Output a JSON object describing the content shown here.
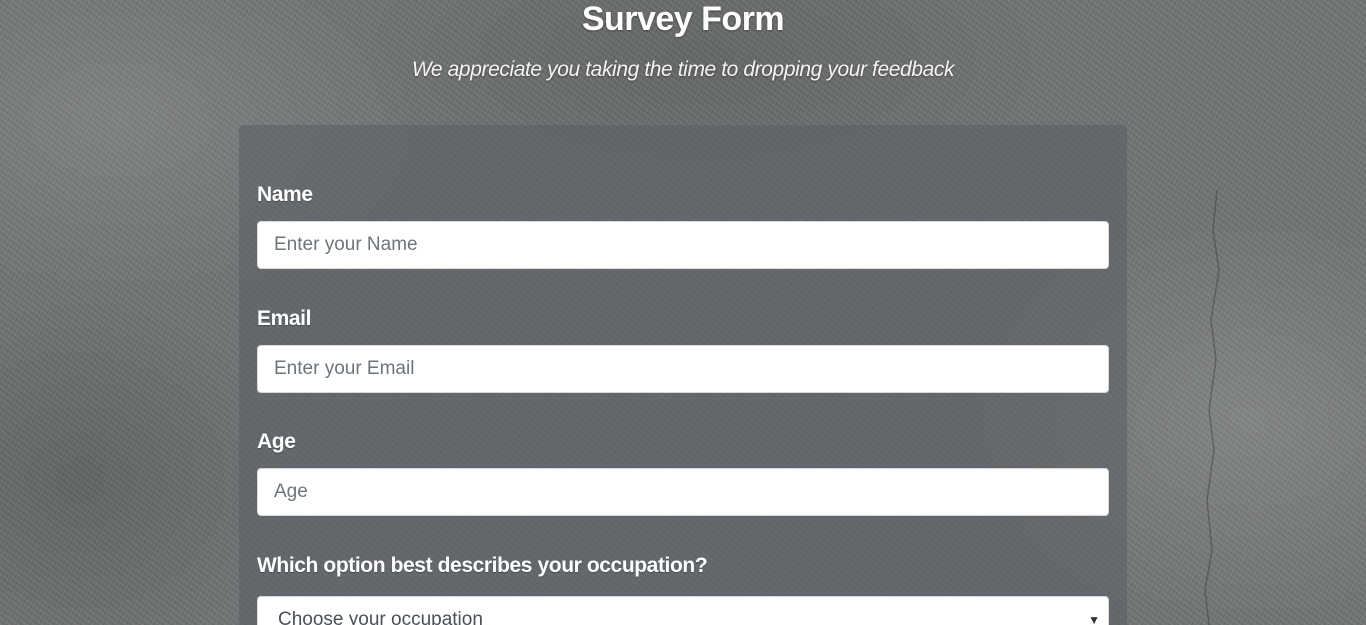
{
  "header": {
    "title": "Survey Form",
    "description": "We appreciate you taking the time to dropping your feedback"
  },
  "form": {
    "name": {
      "label": "Name",
      "placeholder": "Enter your Name"
    },
    "email": {
      "label": "Email",
      "placeholder": "Enter your Email"
    },
    "age": {
      "label": "Age",
      "placeholder": "Age"
    },
    "occupation": {
      "label": "Which option best describes your occupation?",
      "selected": "Choose your occupation",
      "arrow_icon": "dropdown-triangle"
    }
  },
  "colors": {
    "background": "#6f7273",
    "panel": "#5f6468",
    "text": "#ffffff",
    "input_bg": "#ffffff",
    "placeholder": "#6c757d"
  }
}
